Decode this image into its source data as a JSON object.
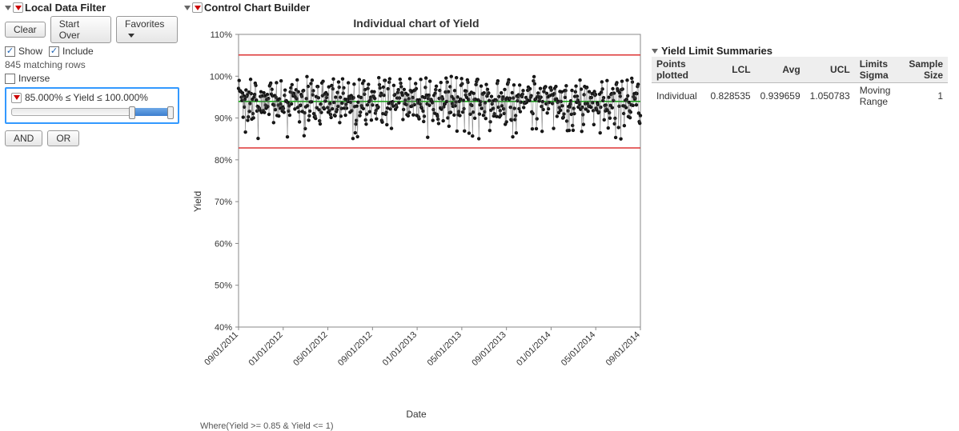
{
  "filter": {
    "title": "Local Data Filter",
    "buttons": {
      "clear": "Clear",
      "startOver": "Start Over",
      "favorites": "Favorites"
    },
    "show_label": "Show",
    "show_checked": true,
    "include_label": "Include",
    "include_checked": true,
    "matching": "845 matching rows",
    "inverse_label": "Inverse",
    "inverse_checked": false,
    "range_text": "85.000% ≤ Yield ≤ 100.000%",
    "and": "AND",
    "or": "OR"
  },
  "builder": {
    "title": "Control Chart Builder",
    "chart_title": "Individual chart of Yield",
    "ylabel": "Yield",
    "xlabel": "Date",
    "where": "Where(Yield >= 0.85 & Yield <= 1)"
  },
  "summaries": {
    "title": "Yield Limit Summaries",
    "headers": {
      "points": "Points plotted",
      "lcl": "LCL",
      "avg": "Avg",
      "ucl": "UCL",
      "limits": "Limits Sigma",
      "n": "Sample Size"
    },
    "row": {
      "points": "Individual",
      "lcl": "0.828535",
      "avg": "0.939659",
      "ucl": "1.050783",
      "limits": "Moving Range",
      "n": "1"
    }
  },
  "chart_data": {
    "type": "control-chart-individual",
    "ylabel": "Yield",
    "xlabel": "Date",
    "y_ticks": [
      40,
      50,
      60,
      70,
      80,
      90,
      100,
      110
    ],
    "y_tick_format": "percent",
    "ylim": [
      40,
      110
    ],
    "x_categories": [
      "09/01/2011",
      "01/01/2012",
      "05/01/2012",
      "09/01/2012",
      "01/01/2013",
      "05/01/2013",
      "09/01/2013",
      "01/01/2014",
      "05/01/2014",
      "09/01/2014"
    ],
    "center_line_pct": 93.97,
    "ucl_pct": 105.08,
    "lcl_pct": 82.85,
    "data_range_pct": [
      85,
      100
    ],
    "n_points": 845,
    "series_description": "Individual yield observations densely plotted between 85% and 100% across the full date range; points connect to form a noisy band; a few dips approach 85%."
  }
}
